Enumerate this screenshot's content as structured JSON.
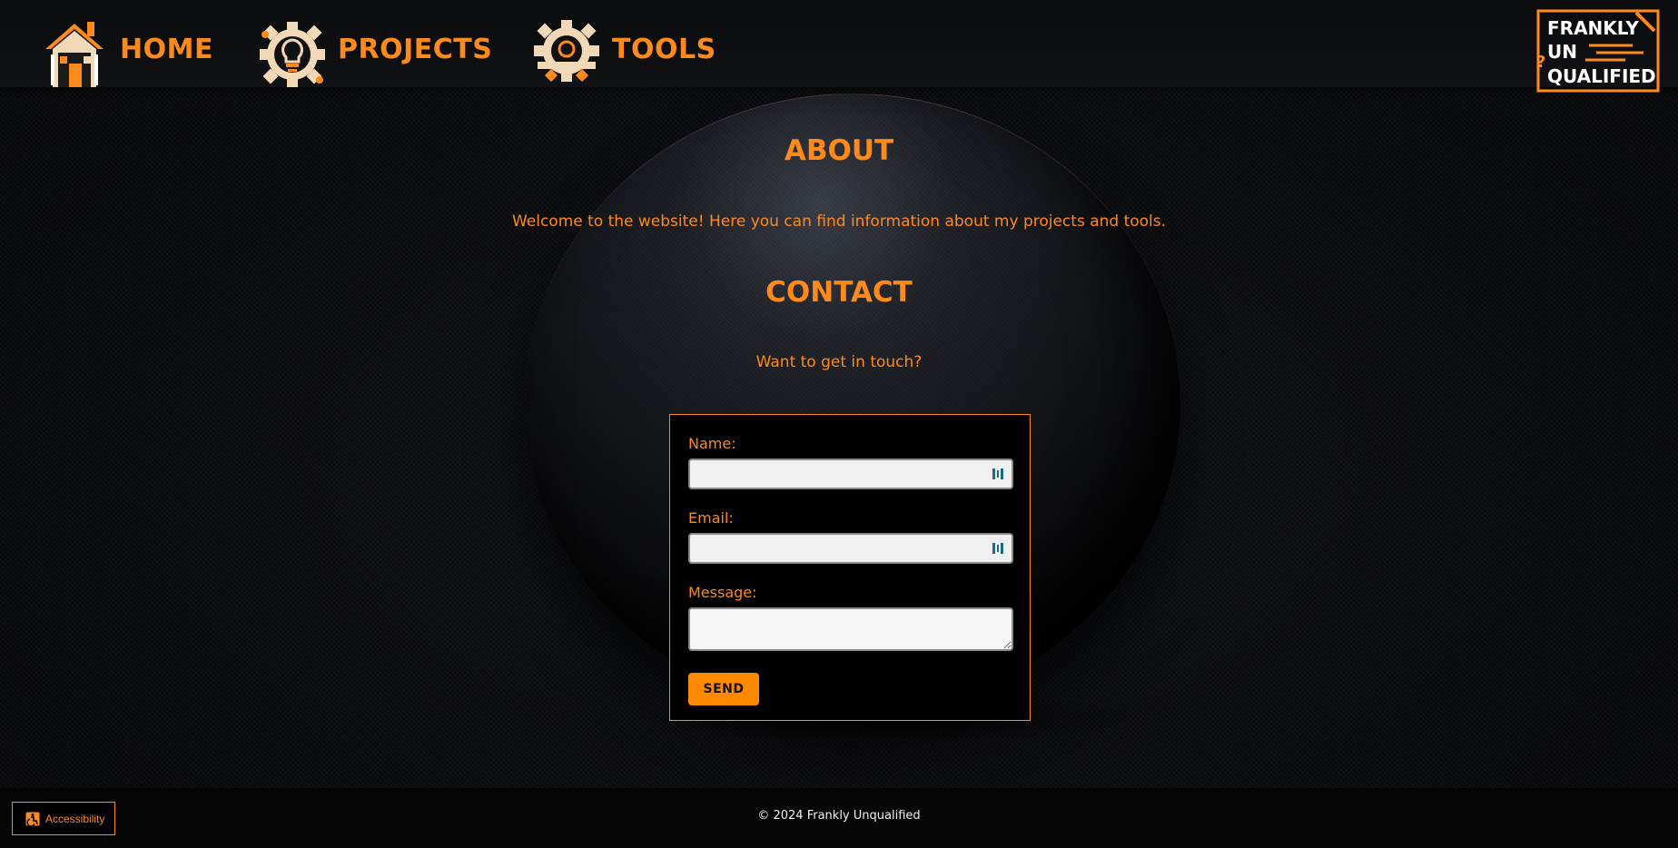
{
  "nav": {
    "items": [
      {
        "label": "HOME",
        "icon": "house-icon"
      },
      {
        "label": "PROJECTS",
        "icon": "gear-lightbulb-icon"
      },
      {
        "label": "TOOLS",
        "icon": "gear-tools-icon"
      }
    ]
  },
  "logo": {
    "lines": [
      "FRANKLY",
      "UN",
      "QUALIFIED"
    ]
  },
  "about": {
    "title": "ABOUT",
    "text": "Welcome to the website! Here you can find information about my projects and tools."
  },
  "contact": {
    "title": "CONTACT",
    "text": "Want to get in touch?",
    "form": {
      "name_label": "Name:",
      "name_value": "",
      "email_label": "Email:",
      "email_value": "",
      "message_label": "Message:",
      "message_value": "",
      "submit_label": "SEND"
    }
  },
  "footer": {
    "copyright": "© 2024 Frankly Unqualified",
    "accessibility_label": "Accessibility"
  },
  "colors": {
    "accent": "#ff8a1c",
    "background": "#0b0c0e",
    "footer_text": "#f2f2f2"
  }
}
